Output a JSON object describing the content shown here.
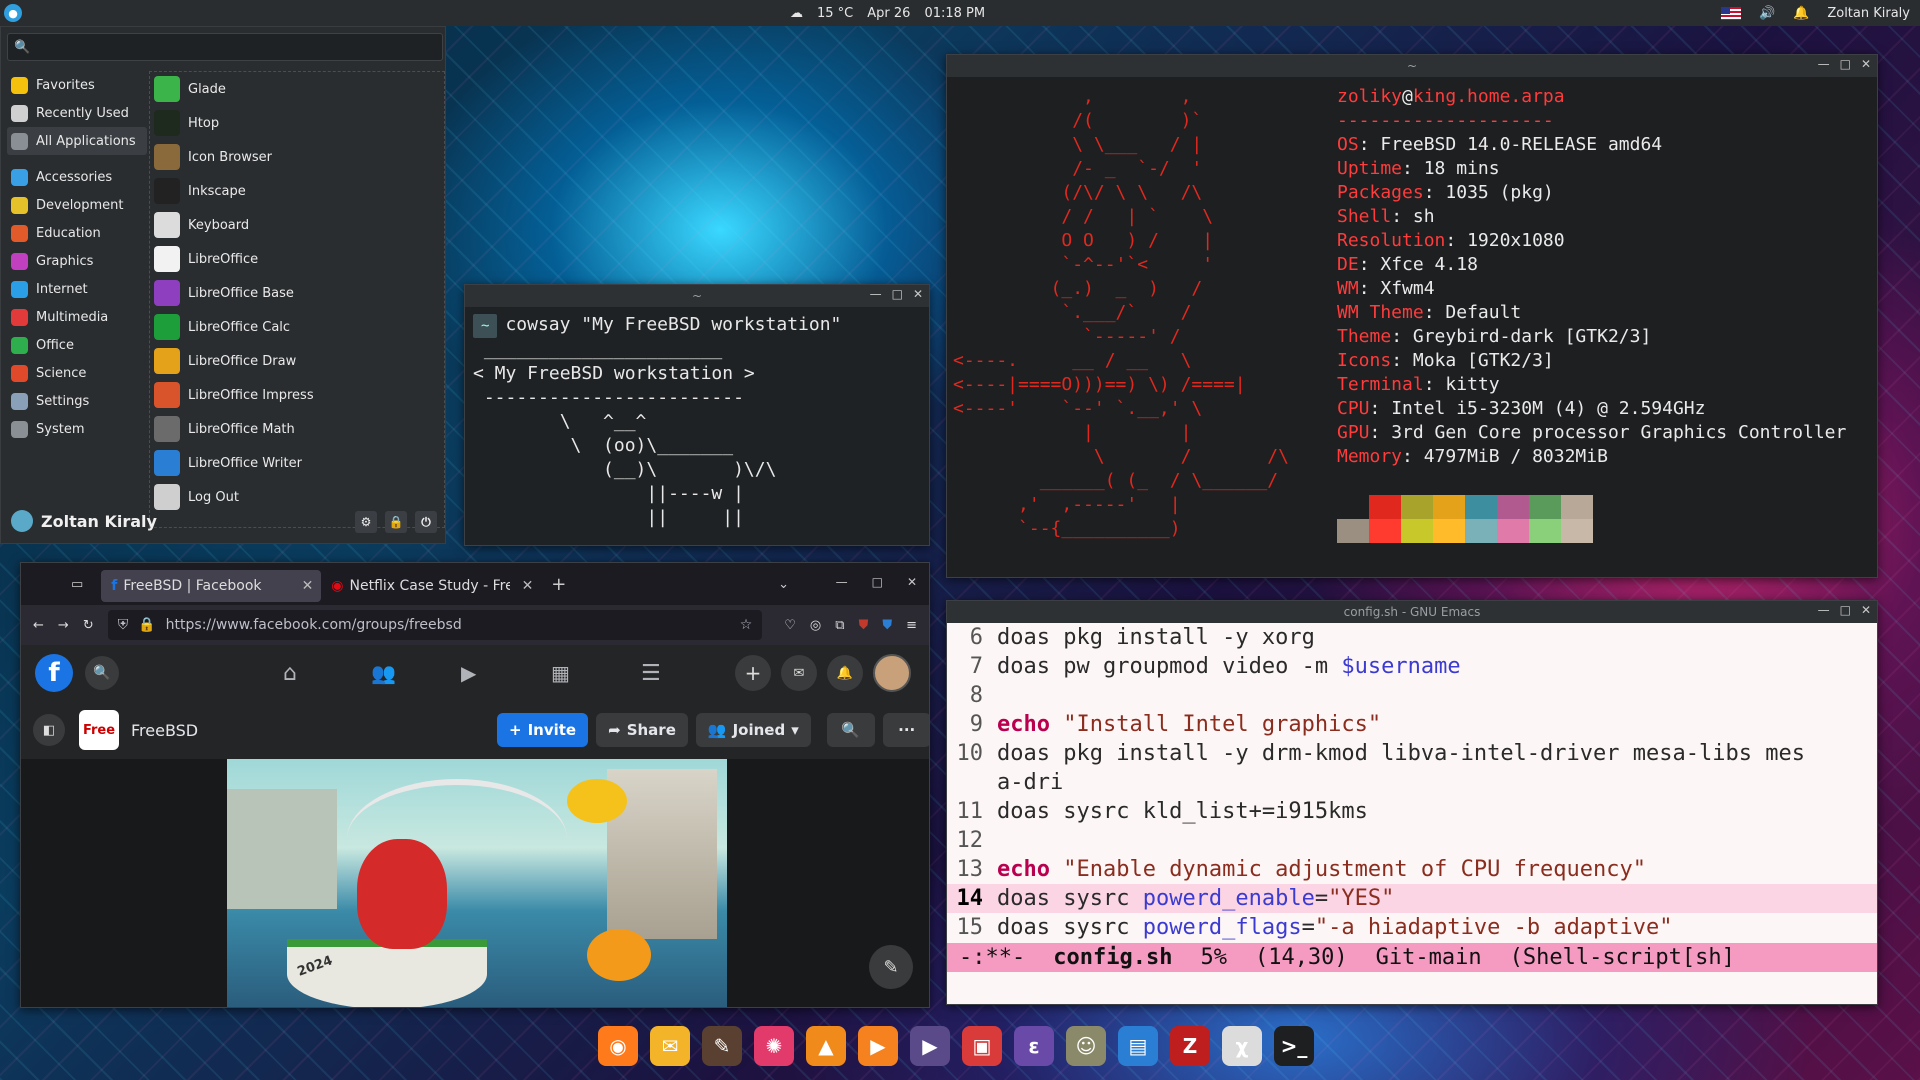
{
  "panel": {
    "weather": "15 °C",
    "date": "Apr 26",
    "time": "01:18 PM",
    "user": "Zoltan Kiraly"
  },
  "menu": {
    "search_value": "",
    "categories": [
      {
        "label": "Favorites",
        "color": "#f4c20d"
      },
      {
        "label": "Recently Used",
        "color": "#d0d0d0"
      },
      {
        "label": "All Applications",
        "color": "#8a8f95"
      },
      {
        "label": "Accessories",
        "color": "#3aa0e6"
      },
      {
        "label": "Development",
        "color": "#e6c22a"
      },
      {
        "label": "Education",
        "color": "#e05a2a"
      },
      {
        "label": "Graphics",
        "color": "#c040c0"
      },
      {
        "label": "Internet",
        "color": "#2a9ee6"
      },
      {
        "label": "Multimedia",
        "color": "#e03a3a"
      },
      {
        "label": "Office",
        "color": "#2fae4e"
      },
      {
        "label": "Science",
        "color": "#e04a2a"
      },
      {
        "label": "Settings",
        "color": "#8aa0b8"
      },
      {
        "label": "System",
        "color": "#8a8f95"
      }
    ],
    "apps": [
      {
        "label": "Glade",
        "color": "#3bb54a"
      },
      {
        "label": "Htop",
        "color": "#1d2a1d"
      },
      {
        "label": "Icon Browser",
        "color": "#8a6a3a"
      },
      {
        "label": "Inkscape",
        "color": "#222"
      },
      {
        "label": "Keyboard",
        "color": "#dcdcdc"
      },
      {
        "label": "LibreOffice",
        "color": "#f2f2f2"
      },
      {
        "label": "LibreOffice Base",
        "color": "#8e3fbf"
      },
      {
        "label": "LibreOffice Calc",
        "color": "#1e9e3a"
      },
      {
        "label": "LibreOffice Draw",
        "color": "#e3a21a"
      },
      {
        "label": "LibreOffice Impress",
        "color": "#d9532b"
      },
      {
        "label": "LibreOffice Math",
        "color": "#6b6b6b"
      },
      {
        "label": "LibreOffice Writer",
        "color": "#2a7fd4"
      },
      {
        "label": "Log Out",
        "color": "#cfcfcf"
      }
    ],
    "user": "Zoltan Kiraly"
  },
  "cowsay": {
    "title": "~",
    "prompt": "~",
    "command": "cowsay \"My FreeBSD workstation\"",
    "output": " ______________________\n< My FreeBSD workstation >\n ------------------------\n        \\   ^__^\n         \\  (oo)\\_______\n            (__)\\       )\\/\\\n                ||----w |\n                ||     ||"
  },
  "neofetch": {
    "title": "~",
    "art": "            ,        ,\n           /(        )`\n           \\ \\___   / |\n           /- _  `-/  '\n          (/\\/ \\ \\   /\\\n          / /   | `    \\\n          O O   ) /    |\n          `-^--'`<     '\n         (_.)  _  )   /\n          `.___/`    /\n            `-----' /\n<----.     __ / __   \\\n<----|====O)))==) \\) /====|\n<----'    `--' `.__,' \\\n            |        |\n             \\       /       /\\\n        ______( (_  / \\______/\n      ,'  ,-----'   |\n      `--{__________)",
    "user": "zoliky",
    "at": "@",
    "host": "king.home.arpa",
    "separator": "--------------------",
    "fields": [
      {
        "k": "OS",
        "v": "FreeBSD 14.0-RELEASE amd64"
      },
      {
        "k": "Uptime",
        "v": "18 mins"
      },
      {
        "k": "Packages",
        "v": "1035 (pkg)"
      },
      {
        "k": "Shell",
        "v": "sh"
      },
      {
        "k": "Resolution",
        "v": "1920x1080"
      },
      {
        "k": "DE",
        "v": "Xfce 4.18"
      },
      {
        "k": "WM",
        "v": "Xfwm4"
      },
      {
        "k": "WM Theme",
        "v": "Default"
      },
      {
        "k": "Theme",
        "v": "Greybird-dark [GTK2/3]"
      },
      {
        "k": "Icons",
        "v": "Moka [GTK2/3]"
      },
      {
        "k": "Terminal",
        "v": "kitty"
      },
      {
        "k": "CPU",
        "v": "Intel i5-3230M (4) @ 2.594GHz"
      },
      {
        "k": "GPU",
        "v": "3rd Gen Core processor Graphics Controller"
      },
      {
        "k": "Memory",
        "v": "4797MiB / 8032MiB"
      }
    ],
    "palette_top": [
      "#1e1f21",
      "#e0281e",
      "#a8a32a",
      "#e3a21a",
      "#3d8fa0",
      "#b05a8f",
      "#5a9a5a",
      "#b8a898"
    ],
    "palette_bottom": [
      "#9a8f80",
      "#ff3b2f",
      "#c8c82a",
      "#ffbb2a",
      "#7ab0b8",
      "#e07aa8",
      "#8ad07a",
      "#c8b8a8"
    ]
  },
  "emacs": {
    "title": "config.sh - GNU Emacs",
    "lines": [
      {
        "n": "6",
        "parts": [
          {
            "t": "doas pkg install -y xorg",
            "c": ""
          }
        ]
      },
      {
        "n": "7",
        "parts": [
          {
            "t": "doas pw groupmod video -m ",
            "c": ""
          },
          {
            "t": "$username",
            "c": "var"
          }
        ]
      },
      {
        "n": "8",
        "parts": []
      },
      {
        "n": "9",
        "parts": [
          {
            "t": "echo",
            "c": "kw"
          },
          {
            "t": " \"Install Intel graphics\"",
            "c": "str"
          }
        ]
      },
      {
        "n": "10",
        "parts": [
          {
            "t": "doas pkg install -y drm-kmod libva-intel-driver mesa-libs mes",
            "c": ""
          }
        ]
      },
      {
        "n": "",
        "parts": [
          {
            "t": "a-dri",
            "c": ""
          }
        ]
      },
      {
        "n": "11",
        "parts": [
          {
            "t": "doas sysrc kld_list+=i915kms",
            "c": ""
          }
        ]
      },
      {
        "n": "12",
        "parts": []
      },
      {
        "n": "13",
        "parts": [
          {
            "t": "echo",
            "c": "kw"
          },
          {
            "t": " \"Enable dynamic adjustment of CPU frequency\"",
            "c": "str"
          }
        ]
      },
      {
        "n": "14",
        "hl": true,
        "parts": [
          {
            "t": "doas sysrc ",
            "c": ""
          },
          {
            "t": "powerd_enable",
            "c": "var"
          },
          {
            "t": "=",
            "c": ""
          },
          {
            "t": "\"YES\"",
            "c": "str"
          }
        ]
      },
      {
        "n": "15",
        "parts": [
          {
            "t": "doas sysrc ",
            "c": ""
          },
          {
            "t": "powerd_flags",
            "c": "var"
          },
          {
            "t": "=",
            "c": ""
          },
          {
            "t": "\"-a hiadaptive -b adaptive\"",
            "c": "str"
          }
        ]
      }
    ],
    "mode_line": {
      "state": "-:**-",
      "file": "config.sh",
      "percent": "5%",
      "pos": "(14,30)",
      "vc": "Git-main",
      "mode": "(Shell-script[sh]"
    }
  },
  "browser": {
    "tabs": [
      {
        "label": "FreeBSD | Facebook"
      },
      {
        "label": "Netflix Case Study - Free"
      }
    ],
    "url": "https://www.facebook.com/groups/freebsd",
    "group_name": "FreeBSD",
    "group_avatar_text": "Free",
    "invite": "Invite",
    "share": "Share",
    "joined": "Joined",
    "banner_text": "2024"
  },
  "dock": {
    "icons": [
      {
        "name": "firefox-icon",
        "color": "#ff7a1a",
        "g": "◉"
      },
      {
        "name": "mail-icon",
        "color": "#f3b429",
        "g": "✉"
      },
      {
        "name": "gimp-icon",
        "color": "#5a4030",
        "g": "✎"
      },
      {
        "name": "pinwheel-icon",
        "color": "#e23a6a",
        "g": "✺"
      },
      {
        "name": "vlc-icon",
        "color": "#f08a1a",
        "g": "▲"
      },
      {
        "name": "media-player-icon",
        "color": "#f5821f",
        "g": "▶"
      },
      {
        "name": "video-icon",
        "color": "#5a4a8a",
        "g": "▶"
      },
      {
        "name": "calendar-icon",
        "color": "#d93a3a",
        "g": "▣"
      },
      {
        "name": "emacs-icon",
        "color": "#6a4aa8",
        "g": "ε"
      },
      {
        "name": "game-icon",
        "color": "#8a8a6a",
        "g": "☺"
      },
      {
        "name": "document-icon",
        "color": "#2a7fd4",
        "g": "▤"
      },
      {
        "name": "filezilla-icon",
        "color": "#bf1e1e",
        "g": "Z"
      },
      {
        "name": "math-icon",
        "color": "#dcdcdc",
        "g": "χ"
      },
      {
        "name": "terminal-icon",
        "color": "#1e1f21",
        "g": ">_"
      }
    ]
  }
}
